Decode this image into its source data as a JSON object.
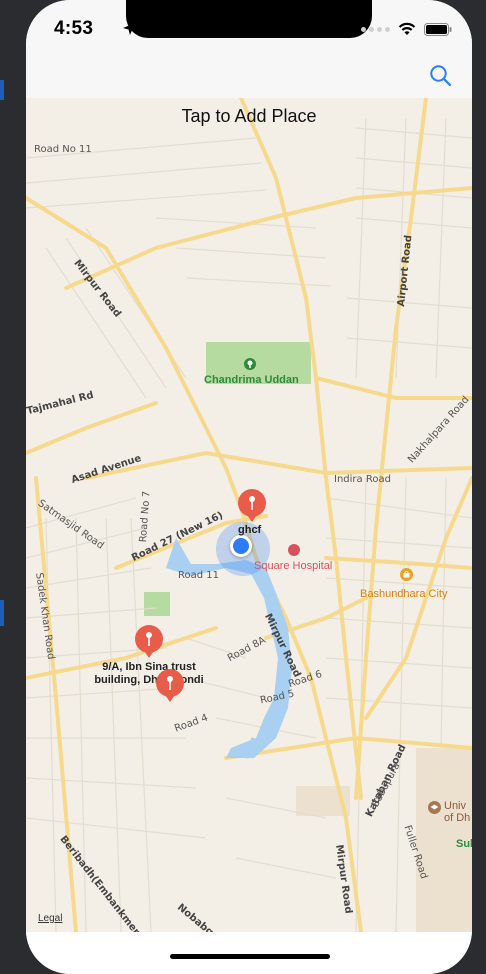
{
  "status_bar": {
    "time": "4:53",
    "icons": [
      "location-arrow-icon",
      "signal-dots-icon",
      "wifi-icon",
      "battery-icon"
    ]
  },
  "nav": {
    "search_icon": "search-icon",
    "accent_color": "#2b7cf6"
  },
  "map": {
    "hint": "Tap to Add Place",
    "legal": "Legal",
    "labels": {
      "road_no_11": "Road No 11",
      "mirpur_road_top": "Mirpur Road",
      "airport_road": "Airport Road",
      "chandrima_uddan": "Chandrima Uddan",
      "tajmahal_rd": "Tajmahal Rd",
      "nakhalpara_road": "Nakhalpara Road",
      "asad_avenue": "Asad Avenue",
      "indira_road": "Indira Road",
      "satmasjid_road": "Satmasjid Road",
      "road_no_7": "Road No 7",
      "road_27": "Road 27 (New 16)",
      "square_hospital": "Square Hospital",
      "bashundhara_city": "Bashundhara City",
      "road_11": "Road 11",
      "sadek_khan_road": "Sadek Khan Road",
      "mirpur_road_mid": "Mirpur Road",
      "road_8a": "Road 8A",
      "road_6": "Road 6",
      "road_5": "Road 5",
      "road_4": "Road 4",
      "kataban_road": "Kataban Road",
      "babupura": "Babupura",
      "univ_dh": "Univ of Dh",
      "fuller_road": "Fuller Road",
      "mirpur_road_bottom": "Mirpur Road",
      "beribadh": "Beribadh(Embankment) R",
      "nobabgonj": "Nobabg",
      "sub": "Sub"
    },
    "pins": [
      {
        "title": "ghcf"
      },
      {
        "title": "9/A, Ibn Sina trust building, Dhanmondi"
      },
      {
        "title": ""
      }
    ]
  }
}
